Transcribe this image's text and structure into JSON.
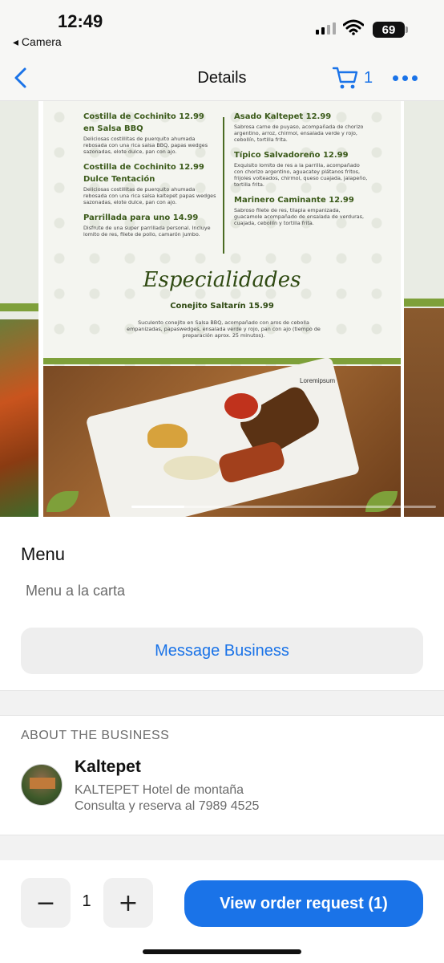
{
  "status_bar": {
    "time": "12:49",
    "back_app": "◂ Camera",
    "battery": "69"
  },
  "nav": {
    "title": "Details",
    "cart_count": "1"
  },
  "menu_image": {
    "left_column": [
      {
        "name": "Costilla de Cochinito  12.99",
        "name2": "en Salsa BBQ",
        "desc": "Deliciosas costillitas de puerquito ahumada rebosada con una rica salsa BBQ, papas wedges sazonadas, elote dulce, pan con ajo."
      },
      {
        "name": "Costilla de Cochinito  12.99",
        "name2": "Dulce Tentación",
        "desc": "Deliciosas costillitas de puerquito ahumada rebosada con una rica salsa kaltepet papas wedges sazonadas, elote dulce, pan con ajo."
      },
      {
        "name": "Parrillada para uno   14.99",
        "name2": "",
        "desc": "Disfrute de una super parrillada personal. Incluye lomito de res, filete de pollo, camarón jumbo."
      }
    ],
    "right_column": [
      {
        "name": "Asado Kaltepet       12.99",
        "desc": "Sabrosa carne de puyaso, acompañada de chorizo argentino, arroz, chirmol, ensalada verde y rojo, cebollín, tortilla frita."
      },
      {
        "name": "Típico Salvadoreño    12.99",
        "desc": "Exquisito lomito de res a la parrilla, acompañado con chorizo argentino, aguacatey plátanos fritos, frijoles volteados, chirmol, queso cuajada, jalapeño, tortilla frita."
      },
      {
        "name": "Marinero Caminante  12.99",
        "desc": "Sabroso filete de res, tilapia empanizada, guacamole acompañado de ensalada de verduras, cuajada, cebollín y tortilla frita."
      }
    ],
    "specials_title": "Especialidades",
    "special_dish": "Conejito Saltarín          15.99",
    "special_desc": "Suculento conejito en Salsa BBQ, acompañado con aros de cebolla empanizadas, papaswedges, ensalada verde y rojo, pan con ajo (tiempo de preparación aprox. 25 minutos).",
    "watermark": "Loremipsum"
  },
  "listing": {
    "title": "Menu",
    "subtitle": "Menu a la carta",
    "message_button": "Message Business"
  },
  "about": {
    "label": "ABOUT THE BUSINESS",
    "name": "Kaltepet",
    "line1": "KALTEPET Hotel de montaña",
    "line2": "Consulta  y reserva al 7989 4525"
  },
  "order": {
    "quantity": "1",
    "minus": "−",
    "plus": "+",
    "button": "View order request (1)"
  },
  "colors": {
    "accent": "#1a73e8",
    "menu_green": "#3b5a1a"
  }
}
